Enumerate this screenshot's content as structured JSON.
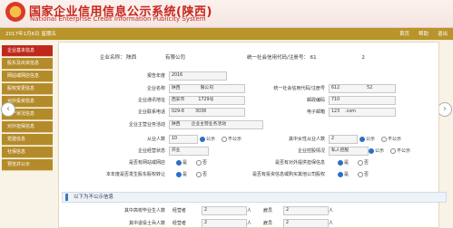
{
  "header": {
    "title": "国家企业信用信息公示系统(陕西)",
    "subtitle": "National Enterprise Credit Information Publicity System"
  },
  "toolbar": {
    "date": "2017年1月6日",
    "date_extra": "星期五",
    "links": [
      "首页",
      "帮助",
      "退出"
    ]
  },
  "sidebar": {
    "items": [
      "企业基本信息",
      "股东及出资信息",
      "网站或网店信息",
      "股权变更信息",
      "对外投资信息",
      "资产状况信息",
      "对外担保信息",
      "党建信息",
      "社保信息",
      "预览并公示"
    ]
  },
  "top": {
    "company_label": "企业名称：",
    "company_value": "陕西",
    "company_suffix": "有限公司",
    "uscc_label": "统一社会信用代码/注册号：",
    "uscc_value": "61",
    "uscc_suffix": "2"
  },
  "form": {
    "year_label": "报告年度",
    "year_value": "2016",
    "name_label": "企业名称",
    "name_value": "陕西",
    "name_suffix": "限公司",
    "code_label": "统一社会信用代码/注册号",
    "code_value": "612",
    "code_suffix": "52",
    "addr_label": "企业通讯地址",
    "addr_value": "西安市",
    "addr_suffix": "1729号",
    "zip_label": "邮政编码",
    "zip_value": "710",
    "phone_label": "企业联系电话",
    "phone_value": "029-8",
    "phone_suffix": "3038",
    "email_label": "电子邮箱",
    "email_value": "123",
    "email_suffix": ".com",
    "biz_label": "企业主营业务活动",
    "biz_value": "陕西",
    "biz_suffix": "企业主营业务活动",
    "staff_label": "从业人数",
    "staff_value": "10",
    "publish": "公示",
    "nopublish": "不公示",
    "women_label": "其中女性从业人数",
    "women_value": "2",
    "status_label": "企业经营状态",
    "status_value": "开业",
    "holding_label": "企业控股情况",
    "holding_value": "私人控股",
    "website_label": "是否有网站或网店",
    "yes": "是",
    "no": "否",
    "guarantee_label": "是否有对外提供担保信息",
    "transfer_label": "本年度是否发生股东股权转让",
    "invest_label": "是否有投资信息或购买其他公司股权"
  },
  "section": {
    "title": "以下为不公示信息"
  },
  "bottom": {
    "row1_label": "其中高校毕业生人数",
    "row1_role": "经营者",
    "row1_val": "2",
    "row1_unit": "人",
    "row1_role2": "雇员",
    "row1_val2": "2",
    "row1_unit2": "人",
    "row2_label": "其中退役士兵人数",
    "row2_role": "经营者",
    "row2_val": "2",
    "row2_unit": "人",
    "row2_role2": "雇员",
    "row2_val2": "2",
    "row2_unit2": "人"
  }
}
